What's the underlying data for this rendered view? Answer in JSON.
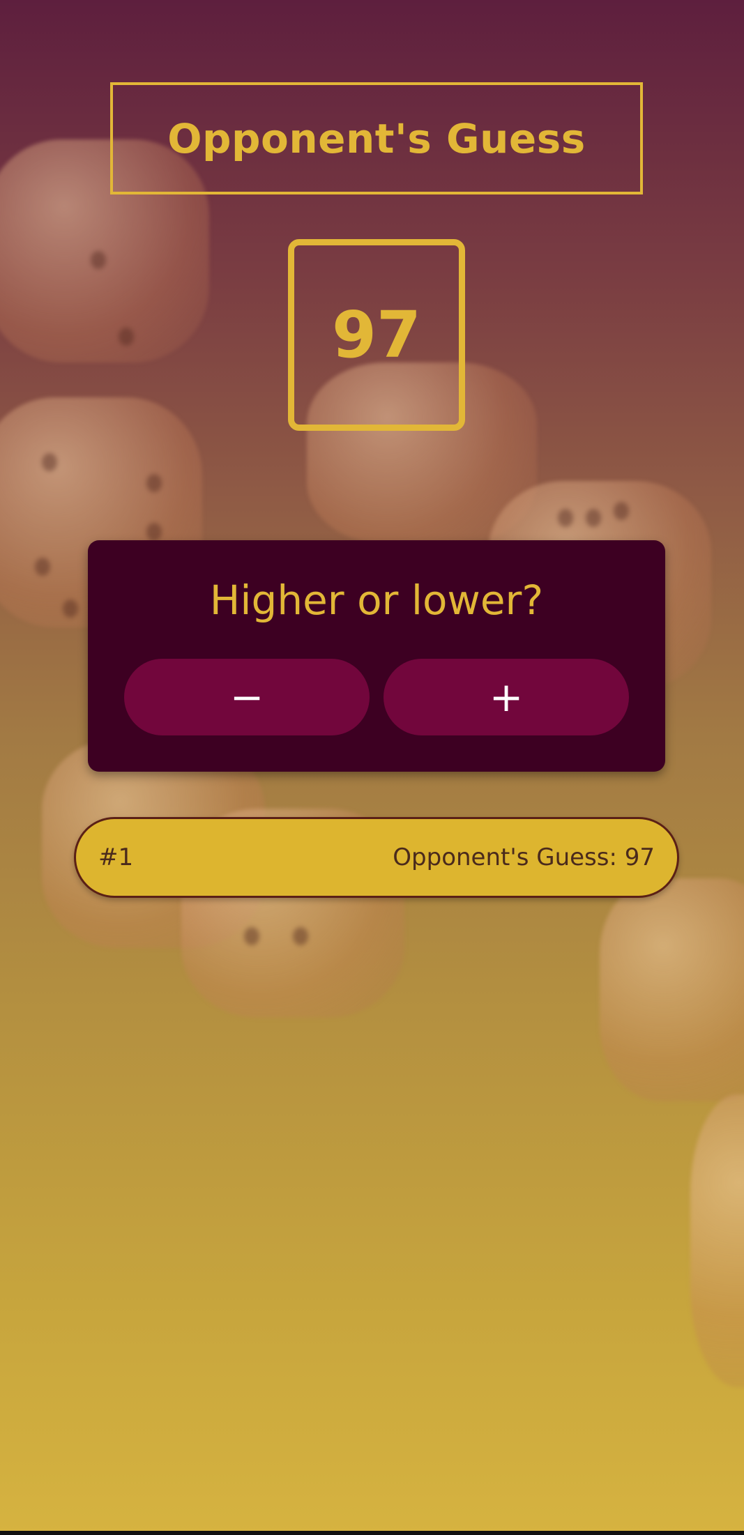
{
  "screen": {
    "title": "Opponent's Guess",
    "current_guess": "97"
  },
  "prompt": {
    "question": "Higher or lower?",
    "lower_label": "−",
    "higher_label": "+"
  },
  "guess_log": [
    {
      "round": "#1",
      "text": "Opponent's Guess: 97"
    }
  ],
  "colors": {
    "accent": "#e2b737",
    "card_bg": "#3d0022",
    "button_bg": "#72063c",
    "log_bg": "#ddb52f"
  }
}
